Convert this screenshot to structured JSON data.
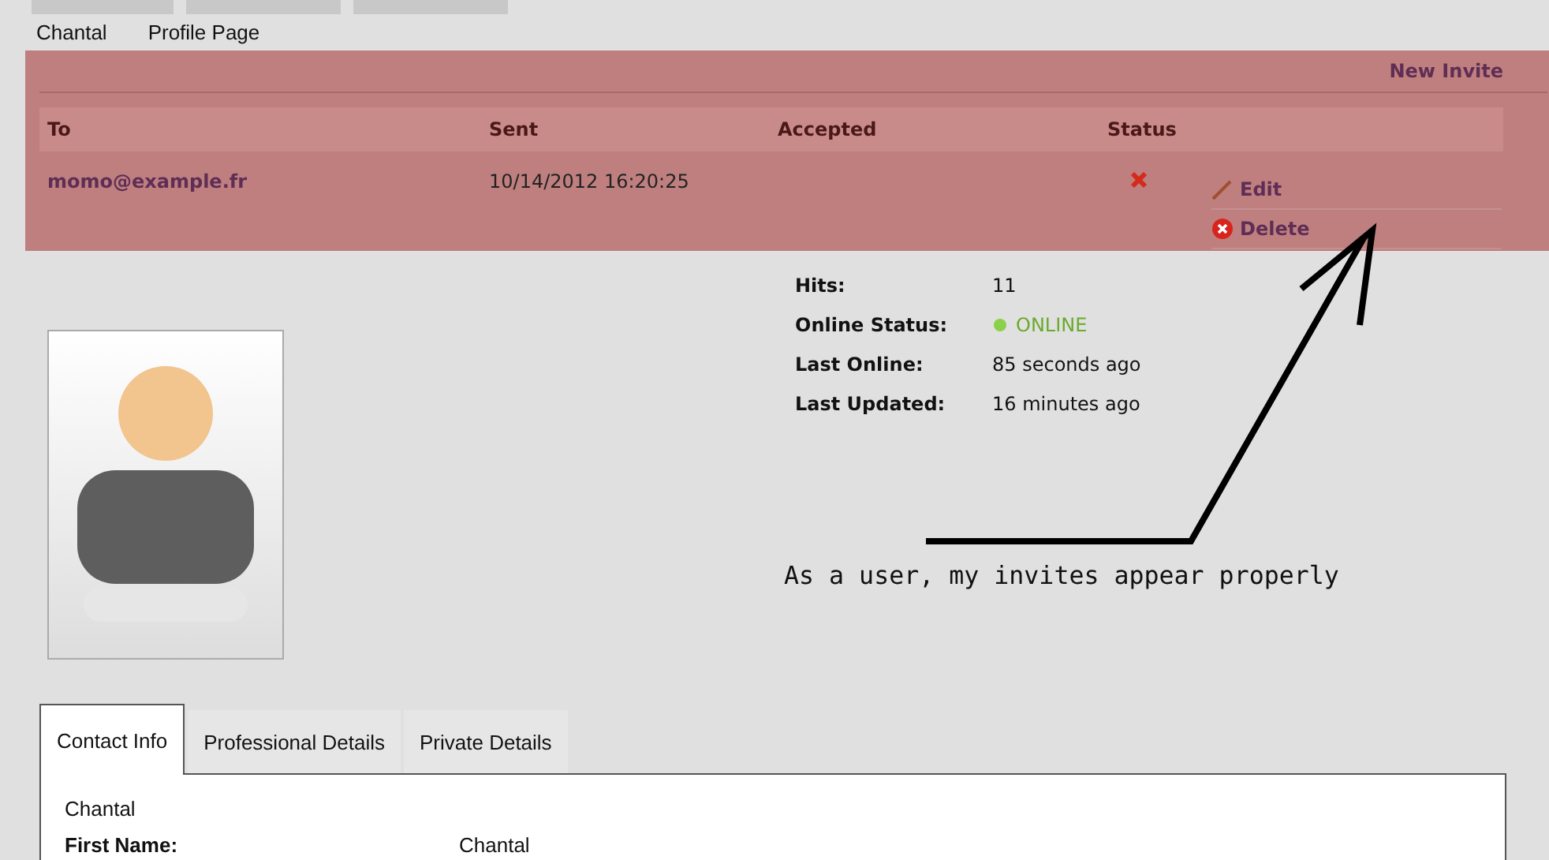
{
  "breadcrumb": [
    "Chantal",
    "Profile Page"
  ],
  "invites": {
    "action": "New Invite",
    "columns": [
      "To",
      "Sent",
      "Accepted",
      "Status"
    ],
    "rows": [
      {
        "to": "momo@example.fr",
        "sent": "10/14/2012 16:20:25",
        "declined": true,
        "actions": [
          {
            "kind": "edit",
            "label": "Edit"
          },
          {
            "kind": "delete",
            "label": "Delete"
          }
        ]
      }
    ]
  },
  "stats": [
    {
      "label": "Hits:",
      "value": "11"
    },
    {
      "label": "Online Status:",
      "value": "ONLINE",
      "kind": "status",
      "online": true
    },
    {
      "label": "Last Online:",
      "value": "85 seconds ago"
    },
    {
      "label": "Last Updated:",
      "value": "16 minutes ago"
    }
  ],
  "annotation": "As a user, my invites appear properly",
  "tabs": [
    {
      "label": "Contact Info",
      "selected": true
    },
    {
      "label": "Professional Details",
      "selected": false
    },
    {
      "label": "Private Details",
      "selected": false
    }
  ],
  "contact": {
    "heading": "Chantal",
    "fields": [
      {
        "label": "First Name:",
        "value": "Chantal"
      }
    ]
  }
}
